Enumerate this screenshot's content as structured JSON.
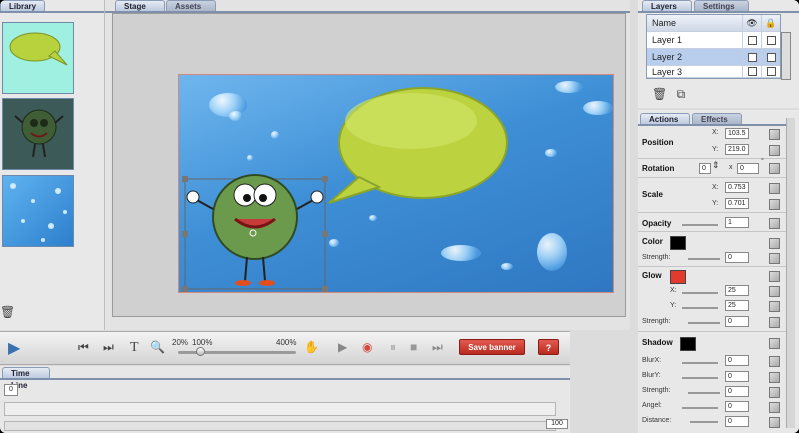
{
  "library": {
    "tab_label": "Library"
  },
  "stage": {
    "tabs": [
      "Stage",
      "Assets"
    ]
  },
  "toolbar": {
    "zoom_min": "20%",
    "zoom_current": "100%",
    "zoom_max": "400%",
    "save_label": "Save banner",
    "help_label": "?"
  },
  "timeline": {
    "tab_label": "Time Line",
    "current_frame": "0",
    "end_frame": "100"
  },
  "layers": {
    "tabs": [
      "Layers",
      "Settings"
    ],
    "header_name": "Name",
    "rows": [
      {
        "name": "Layer 1"
      },
      {
        "name": "Layer 2"
      },
      {
        "name": "Layer 3"
      }
    ]
  },
  "props": {
    "tabs": [
      "Actions",
      "Effects"
    ],
    "position_label": "Position",
    "x_label": "X:",
    "y_label": "Y:",
    "position_x": "103.5",
    "position_y": "219.0",
    "rotation_label": "Rotation",
    "rotation_value": "0",
    "rotation_times": "x",
    "rotation_extra": "0",
    "degree": "°",
    "scale_label": "Scale",
    "scale_x": "0.753",
    "scale_y": "0.701",
    "opacity_label": "Opacity",
    "opacity_value": "1",
    "color_label": "Color",
    "color_swatch": "#000000",
    "strength_label": "Strength:",
    "color_strength": "0",
    "glow_label": "Glow",
    "glow_swatch": "#e23a2c",
    "glow_x": "25",
    "glow_y": "25",
    "glow_strength": "0",
    "shadow_label": "Shadow",
    "shadow_swatch": "#000000",
    "blurx_label": "BlurX:",
    "blury_label": "BlurY:",
    "angle_label": "Angel:",
    "distance_label": "Distance:",
    "shadow_blurx": "0",
    "shadow_blury": "0",
    "shadow_strength": "0",
    "shadow_angle": "0",
    "shadow_distance": "0"
  }
}
